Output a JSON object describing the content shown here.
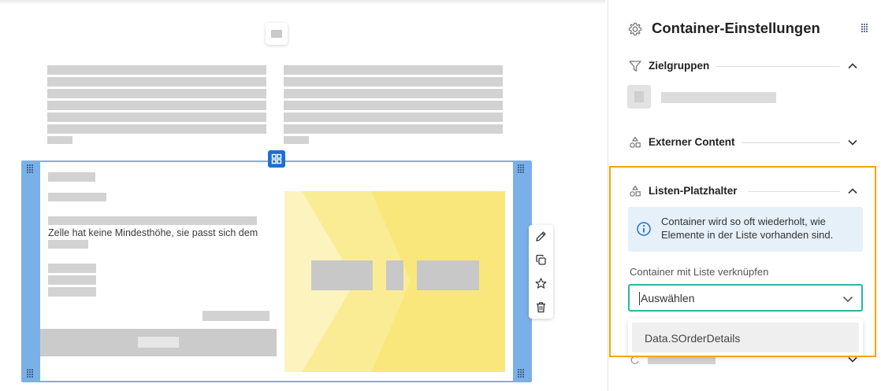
{
  "canvas": {
    "cell_text": "Zelle hat keine Mindesthöhe, sie passt sich dem"
  },
  "toolbar": {
    "items": [
      "pencil-icon",
      "copy-icon",
      "star-icon",
      "trash-icon"
    ]
  },
  "panel": {
    "title": "Container-Einstellungen",
    "sections": {
      "zielgruppen": {
        "label": "Zielgruppen",
        "expanded": true
      },
      "externer_content": {
        "label": "Externer Content",
        "expanded": false
      },
      "listen_platzhalter": {
        "label": "Listen-Platzhalter",
        "expanded": true,
        "info": "Container wird so oft wiederholt, wie Elemente in der Liste vorhanden sind.",
        "field_label": "Container mit Liste verknüpfen",
        "select": {
          "placeholder": "Auswählen",
          "options": [
            "Data.SOrderDetails"
          ]
        }
      }
    }
  },
  "colors": {
    "selection_blue": "#7ab0e8",
    "badge_blue": "#1f6fd1",
    "highlight_orange": "#f2a60c",
    "focus_teal": "#2fb3a3",
    "image_yellow": "#f9e77c",
    "info_background": "#e6f0f9"
  }
}
